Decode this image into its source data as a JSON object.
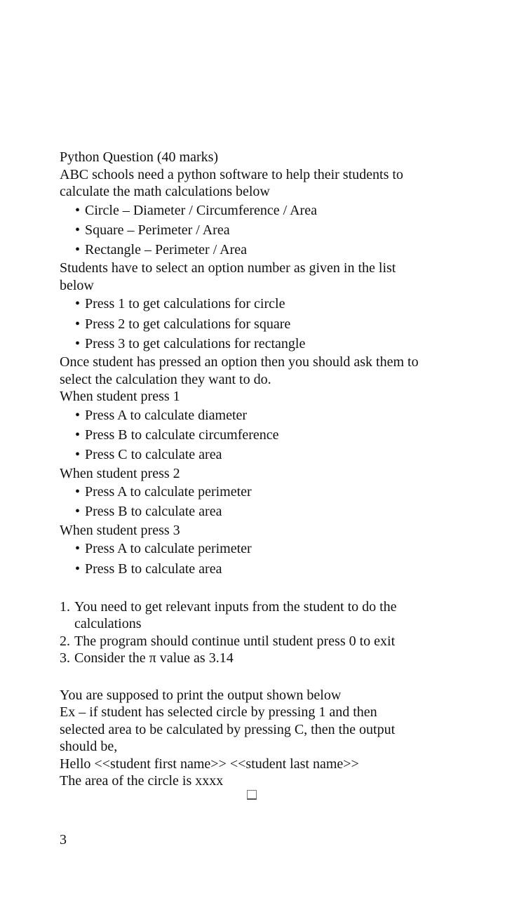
{
  "document": {
    "title": "Python Question (40 marks)",
    "intro": "ABC schools need a python software to help their students to calculate the math calculations below",
    "intro_line1": "ABC schools need a python software to help their students to",
    "intro_line2": "calculate the math calculations below",
    "shapes": [
      "Circle – Diameter / Circumference / Area",
      "Square – Perimeter / Area",
      "Rectangle – Perimeter / Area"
    ],
    "select_line1": "Students have to select an option number as given in the list",
    "select_line2": "below",
    "options": [
      "Press 1 to get calculations for circle",
      "Press 2 to get calculations for square",
      "Press 3 to get calculations for rectangle"
    ],
    "once_line1": "Once student has pressed an option then you should ask them to",
    "once_line2": "select the calculation they want to do.",
    "press1_heading": "When student press 1",
    "press1_items": [
      "Press A to calculate diameter",
      "Press B to calculate circumference",
      "Press C to calculate area"
    ],
    "press2_heading": "When student press 2",
    "press2_items": [
      "Press A to calculate perimeter",
      "Press B to calculate area"
    ],
    "press3_heading": "When student press 3",
    "press3_items": [
      "Press A to calculate perimeter",
      "Press B to calculate area"
    ],
    "requirements": [
      {
        "num": "1.",
        "line1": "You need to get relevant inputs from the student to do the",
        "line2": "calculations"
      },
      {
        "num": "2.",
        "line1": "The program should continue until student press 0 to exit",
        "line2": ""
      },
      {
        "num": "3.",
        "line1": "Consider the π value as 3.14",
        "line2": ""
      }
    ],
    "output_line1": "You are supposed to print the output shown below",
    "output_line2": "Ex – if student has selected circle by pressing 1 and then",
    "output_line3": "selected area to be calculated by pressing C, then the output",
    "output_line4": "should be,",
    "output_line5": "Hello <<student first name>> <<student last name>>",
    "output_line6": "The area of the circle is xxxx",
    "page_number": "3"
  }
}
